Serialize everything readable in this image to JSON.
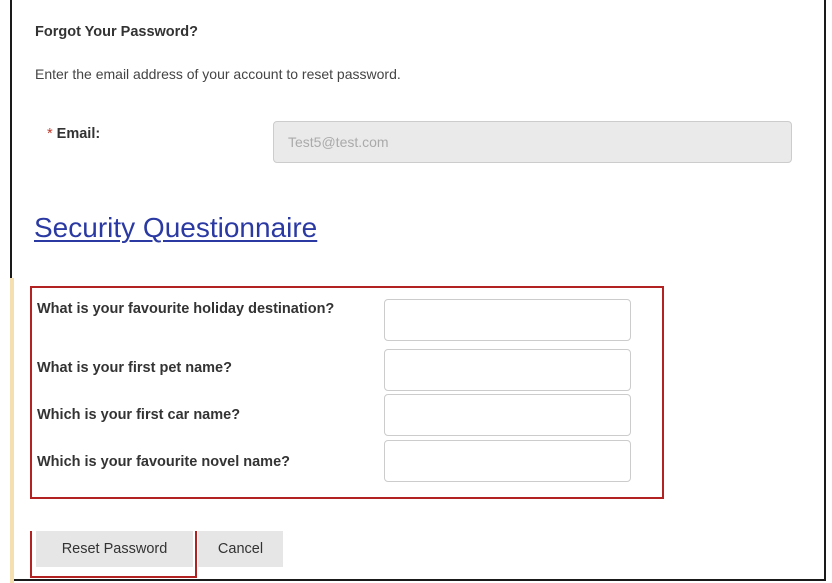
{
  "form": {
    "title": "Forgot Your Password?",
    "instructions": "Enter the email address of your account to reset password.",
    "email": {
      "required_marker": "*",
      "label": "Email:",
      "value": "Test5@test.com"
    }
  },
  "security": {
    "heading": "Security Questionnaire",
    "questions": [
      {
        "label": "What is your favourite holiday destination?",
        "value": ""
      },
      {
        "label": "What is your first pet name?",
        "value": ""
      },
      {
        "label": "Which is your first car name?",
        "value": ""
      },
      {
        "label": "Which is your favourite novel name?",
        "value": ""
      }
    ]
  },
  "actions": {
    "reset_label": "Reset Password",
    "cancel_label": "Cancel"
  },
  "colors": {
    "heading_link": "#2b3aa3",
    "highlight_border": "#b22222",
    "required_marker": "#c0392b"
  }
}
